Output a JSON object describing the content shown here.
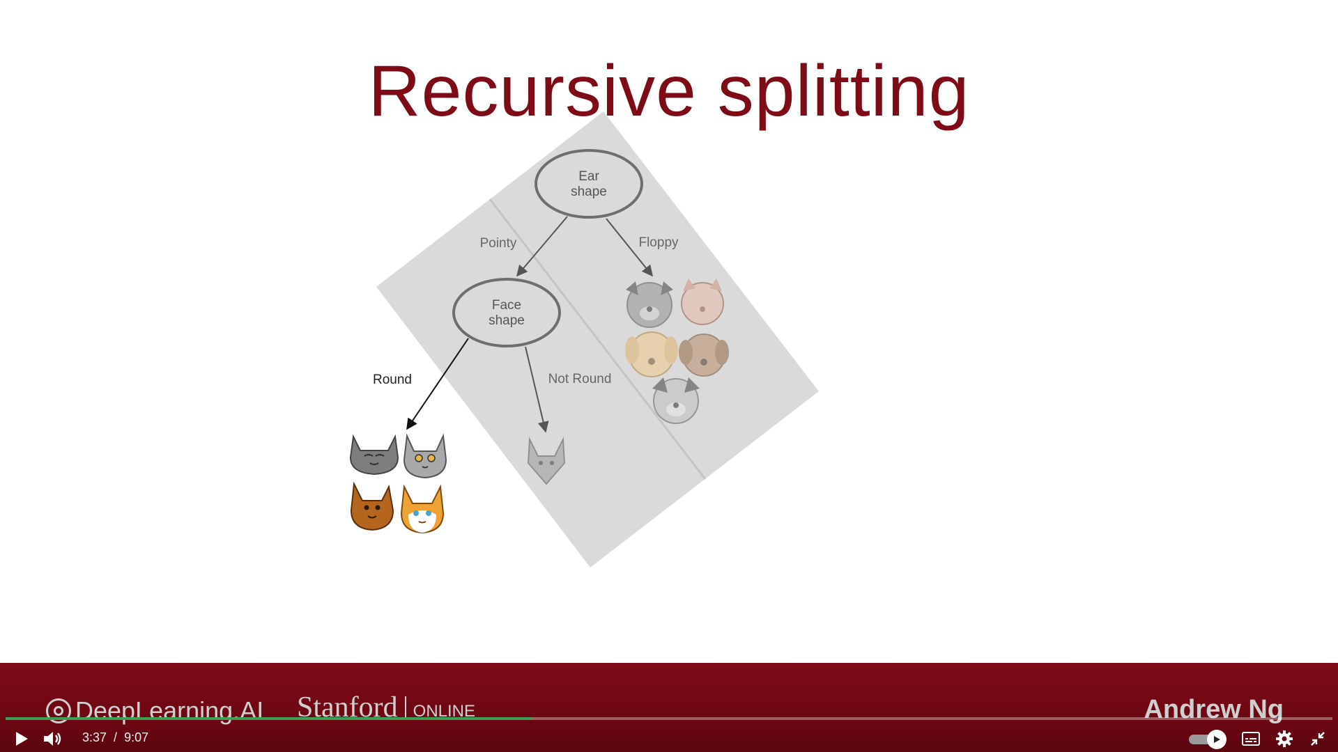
{
  "slide": {
    "title": "Recursive splitting",
    "nodes": {
      "root": [
        "Ear",
        "shape"
      ],
      "child": [
        "Face",
        "shape"
      ]
    },
    "branches": {
      "pointy": "Pointy",
      "floppy": "Floppy",
      "round": "Round",
      "not_round": "Not Round"
    }
  },
  "footer": {
    "brand_left": "DeepLearning.AI",
    "brand_center": "Stanford",
    "brand_center_suffix": "ONLINE",
    "instructor": "Andrew Ng"
  },
  "player": {
    "current_time": "3:37",
    "time_separator": "/",
    "duration": "9:07",
    "progress": 0.397,
    "accent_color": "#3ea055",
    "controls": [
      "play-icon",
      "volume-icon",
      "autoplay-toggle",
      "closed-captions-icon",
      "gear-icon",
      "exit-fullscreen-icon"
    ]
  }
}
